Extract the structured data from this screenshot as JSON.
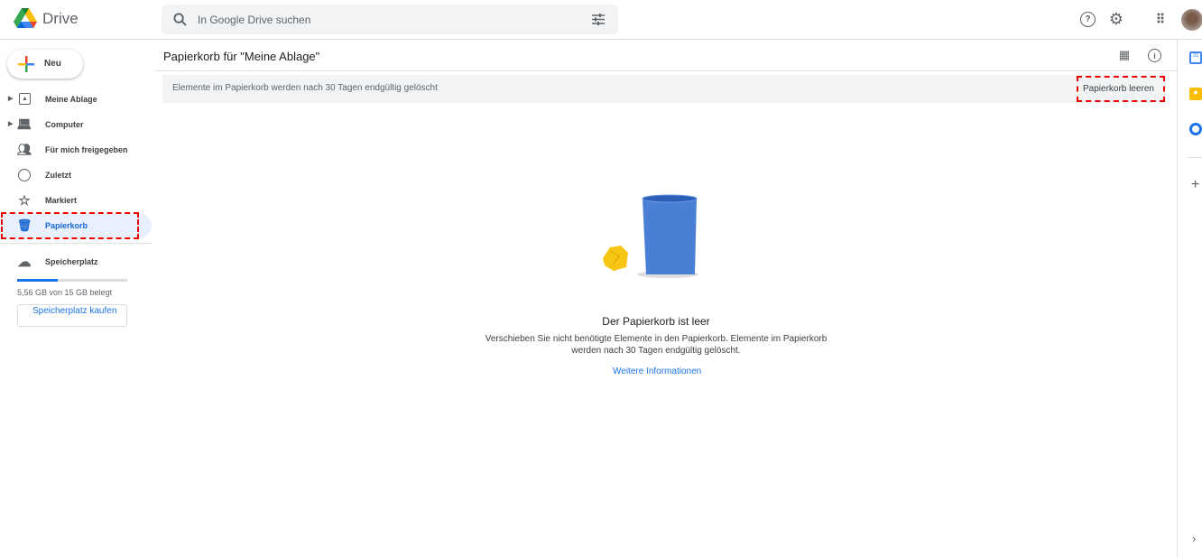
{
  "app": {
    "name": "Drive"
  },
  "search": {
    "placeholder": "In Google Drive suchen"
  },
  "new_button": "Neu",
  "sidebar": {
    "items": [
      {
        "label": "Meine Ablage"
      },
      {
        "label": "Computer"
      },
      {
        "label": "Für mich freigegeben"
      },
      {
        "label": "Zuletzt"
      },
      {
        "label": "Markiert"
      },
      {
        "label": "Papierkorb"
      }
    ],
    "storage": {
      "label": "Speicherplatz",
      "usage": "5,56 GB von 15 GB belegt",
      "fraction": 0.37,
      "buy": "Speicherplatz kaufen"
    }
  },
  "main": {
    "title": "Papierkorb für \"Meine Ablage\"",
    "banner": "Elemente im Papierkorb werden nach 30 Tagen endgültig gelöscht",
    "empty_button": "Papierkorb leeren",
    "empty_title": "Der Papierkorb ist leer",
    "empty_text1": "Verschieben Sie nicht benötigte Elemente in den Papierkorb. Elemente im Papierkorb",
    "empty_text2": "werden nach 30 Tagen endgültig gelöscht.",
    "more_link": "Weitere Informationen"
  },
  "colors": {
    "accent": "#1a73e8",
    "highlight": "#e00000"
  }
}
